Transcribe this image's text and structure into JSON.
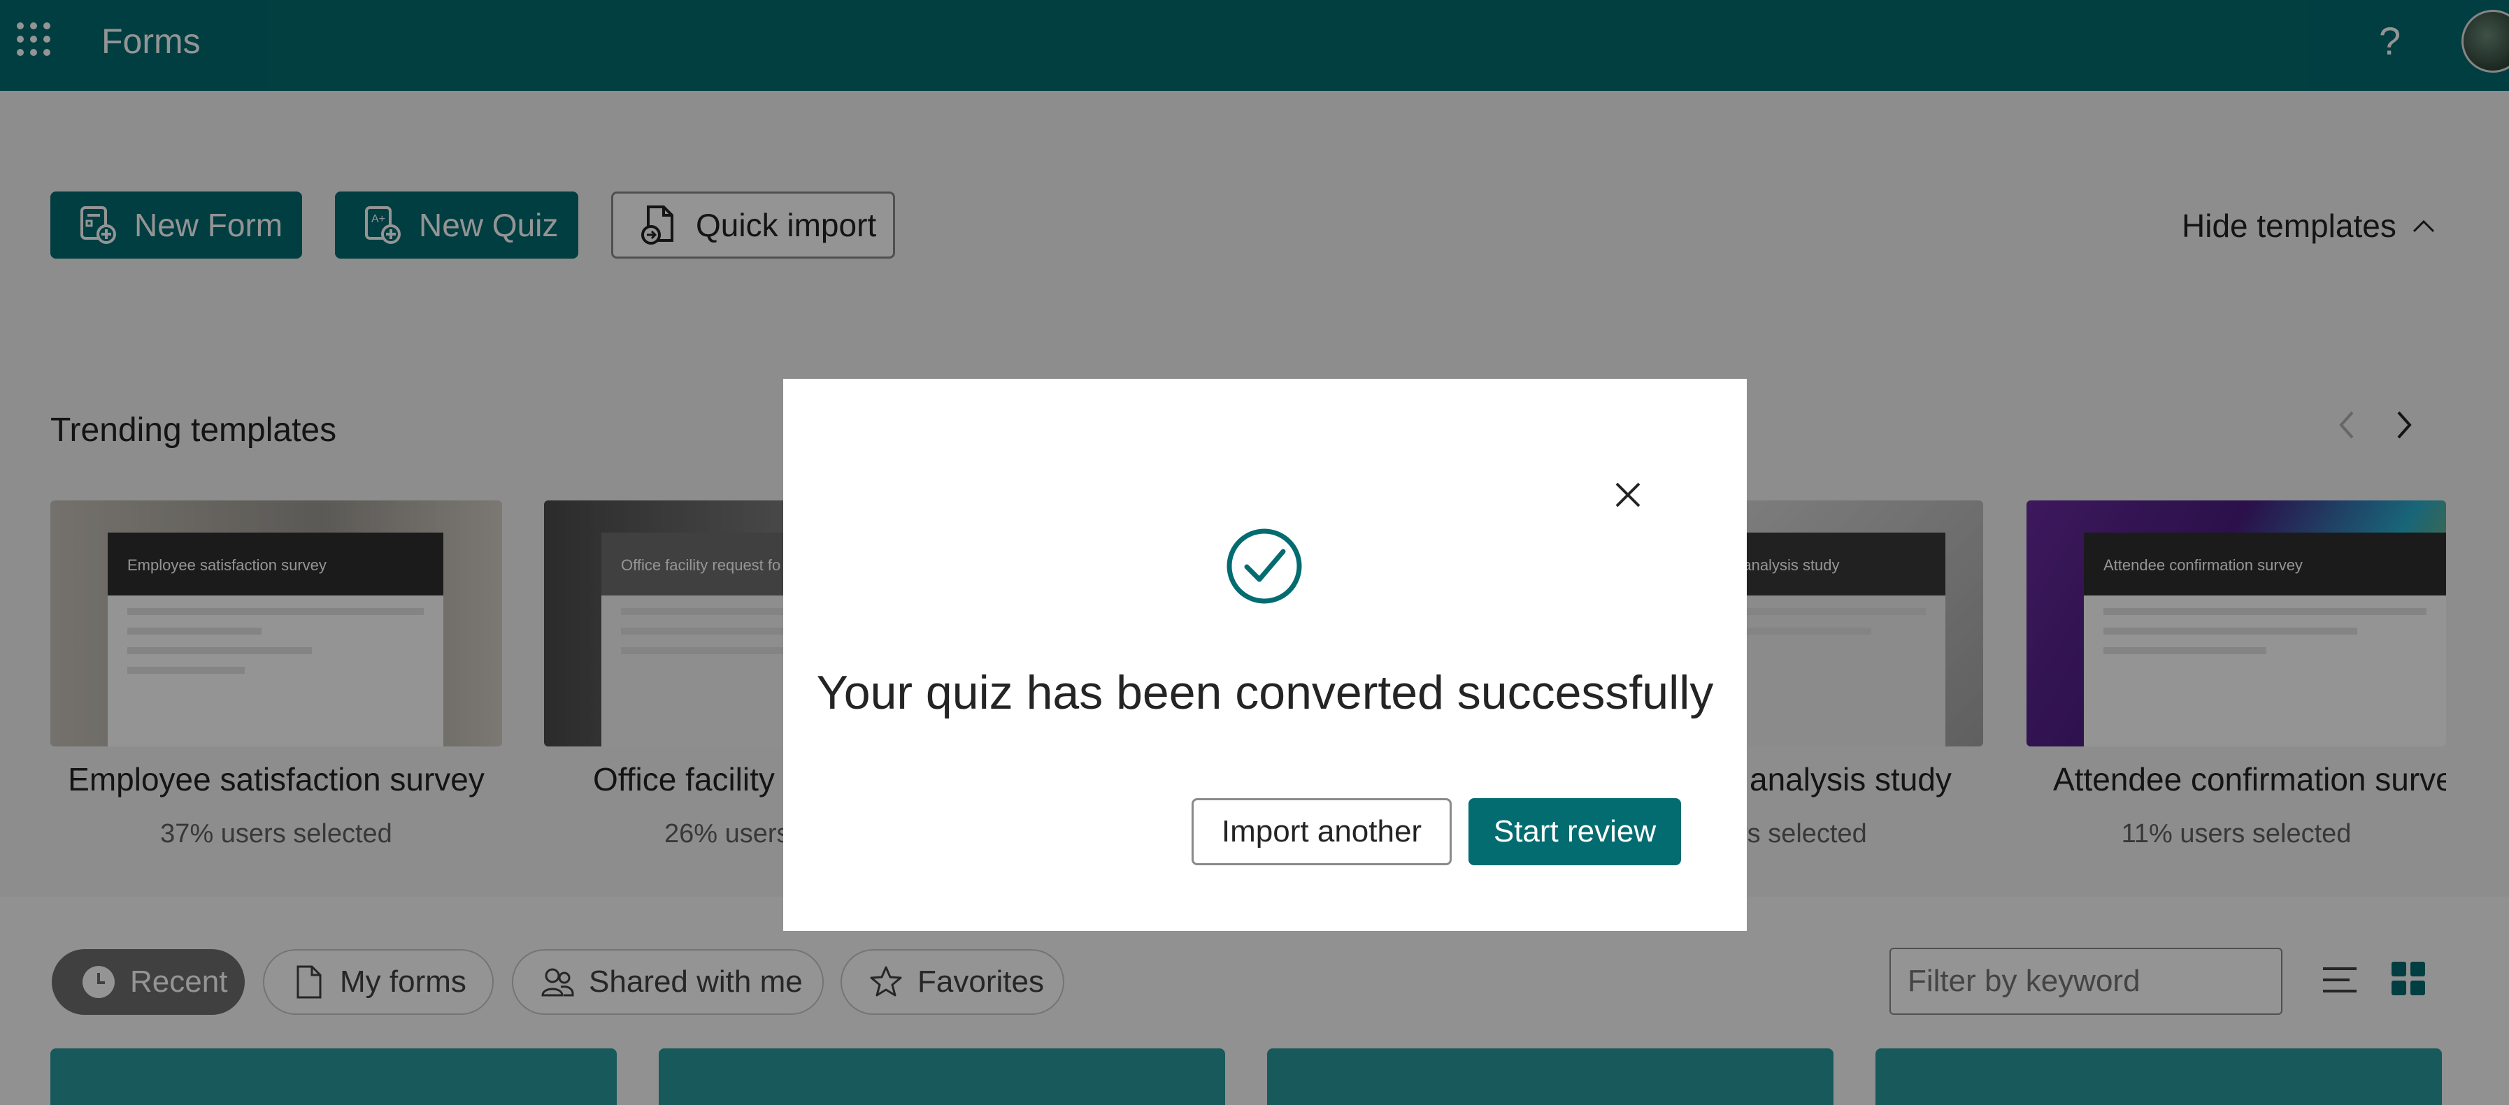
{
  "header": {
    "app_title": "Forms",
    "help_label": "?",
    "waffle_icon": "app-launcher-icon",
    "avatar_icon": "user-avatar"
  },
  "actions": {
    "new_form": "New Form",
    "new_quiz": "New Quiz",
    "quick_import": "Quick import",
    "hide_templates": "Hide templates"
  },
  "templates": {
    "section_title": "Trending templates",
    "items": [
      {
        "name": "Employee satisfaction survey",
        "usage": "37% users selected",
        "thumb_title": "Employee satisfaction survey"
      },
      {
        "name": "Office facility r",
        "usage": "26% users",
        "thumb_title": "Office facility request fo"
      },
      {
        "name": "analysis study",
        "usage": "rs selected",
        "thumb_title": "e analysis study"
      },
      {
        "name": "Attendee confirmation survey",
        "usage": "11% users selected",
        "thumb_title": "Attendee confirmation survey"
      }
    ]
  },
  "filters": {
    "tabs": [
      {
        "label": "Recent",
        "icon": "clock-icon",
        "active": true
      },
      {
        "label": "My forms",
        "icon": "document-icon",
        "active": false
      },
      {
        "label": "Shared with me",
        "icon": "people-icon",
        "active": false
      },
      {
        "label": "Favorites",
        "icon": "star-icon",
        "active": false
      }
    ],
    "search_placeholder": "Filter by keyword"
  },
  "dialog": {
    "message": "Your quiz has been converted successfully",
    "import_another": "Import another",
    "start_review": "Start review",
    "status_icon": "checkmark-circle-icon",
    "close_icon": "close-icon"
  },
  "colors": {
    "brand": "#036c70",
    "overlay": "rgba(0,0,0,0.42)"
  }
}
